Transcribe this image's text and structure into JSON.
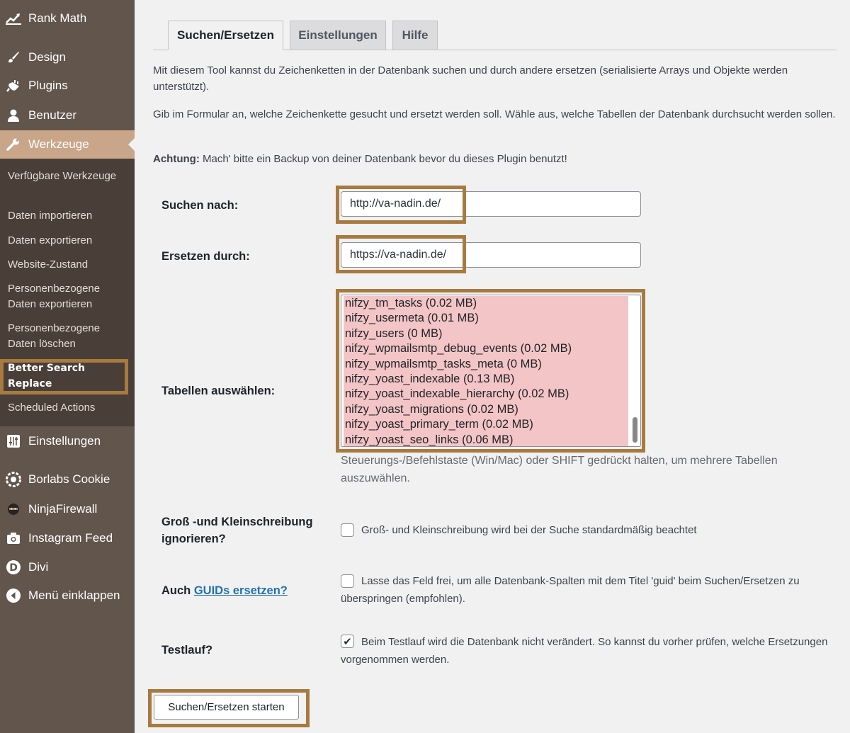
{
  "sidebar": {
    "top_item": {
      "label": "Rank Math",
      "icon": "rank-math-icon"
    },
    "items": [
      {
        "label": "Design",
        "icon": "paintbrush-icon"
      },
      {
        "label": "Plugins",
        "icon": "plug-icon"
      },
      {
        "label": "Benutzer",
        "icon": "user-icon"
      },
      {
        "label": "Werkzeuge",
        "icon": "wrench-icon"
      }
    ],
    "submenu": [
      "Verfügbare Werkzeuge",
      "Daten importieren",
      "Daten exportieren",
      "Website-Zustand",
      "Personenbezogene Daten exportieren",
      "Personenbezogene Daten löschen",
      "Better Search Replace",
      "Scheduled Actions"
    ],
    "lower_items": [
      {
        "label": "Einstellungen",
        "icon": "sliders-icon"
      },
      {
        "label": "Borlabs Cookie",
        "icon": "cookie-icon"
      },
      {
        "label": "NinjaFirewall",
        "icon": "ninja-icon"
      },
      {
        "label": "Instagram Feed",
        "icon": "camera-icon"
      },
      {
        "label": "Divi",
        "icon": "divi-icon"
      },
      {
        "label": "Menü einklappen",
        "icon": "collapse-arrow-icon"
      }
    ],
    "highlight_color": "#a87a3f",
    "active_color": "#c9a58a"
  },
  "tabs": [
    "Suchen/Ersetzen",
    "Einstellungen",
    "Hilfe"
  ],
  "intro": {
    "p1": "Mit diesem Tool kannst du Zeichenketten in der Datenbank suchen und durch andere ersetzen (serialisierte Arrays und Objekte werden unterstützt).",
    "p2": "Gib im Formular an, welche Zeichenkette gesucht und ersetzt werden soll. Wähle aus, welche Tabellen der Datenbank durchsucht werden sollen.",
    "warning_bold": "Achtung:",
    "warning_text": " Mach' bitte ein Backup von deiner Datenbank bevor du dieses Plugin benutzt!"
  },
  "form": {
    "search_label": "Suchen nach:",
    "search_value": "http://va-nadin.de/",
    "replace_label": "Ersetzen durch:",
    "replace_value": "https://va-nadin.de/",
    "tables_label": "Tabellen auswählen:",
    "tables": [
      "nifzy_tm_tasks (0.02 MB)",
      "nifzy_usermeta (0.01 MB)",
      "nifzy_users (0 MB)",
      "nifzy_wpmailsmtp_debug_events (0.02 MB)",
      "nifzy_wpmailsmtp_tasks_meta (0 MB)",
      "nifzy_yoast_indexable (0.13 MB)",
      "nifzy_yoast_indexable_hierarchy (0.02 MB)",
      "nifzy_yoast_migrations (0.02 MB)",
      "nifzy_yoast_primary_term (0.02 MB)",
      "nifzy_yoast_seo_links (0.06 MB)"
    ],
    "tables_selected_color": "#f4c5c6",
    "tables_help": "Steuerungs-/Befehlstaste (Win/Mac) oder SHIFT gedrückt halten, um mehrere Tabellen auszuwählen.",
    "case_label": "Groß -und Kleinschreibung ignorieren?",
    "case_text": "Groß- und Kleinschreibung wird bei der Suche standardmäßig beachtet",
    "case_checked": false,
    "guid_label_prefix": "Auch ",
    "guid_link": "GUIDs ersetzen?",
    "guid_text": "Lasse das Feld frei, um alle Datenbank-Spalten mit dem Titel 'guid' beim Suchen/Ersetzen zu überspringen (empfohlen).",
    "guid_checked": false,
    "dry_label": "Testlauf?",
    "dry_text": "Beim Testlauf wird die Datenbank nicht verändert. So kannst du vorher prüfen, welche Ersetzungen vorgenommen werden.",
    "dry_checked": true,
    "checkmark": "✔",
    "submit_label": "Suchen/Ersetzen starten"
  }
}
